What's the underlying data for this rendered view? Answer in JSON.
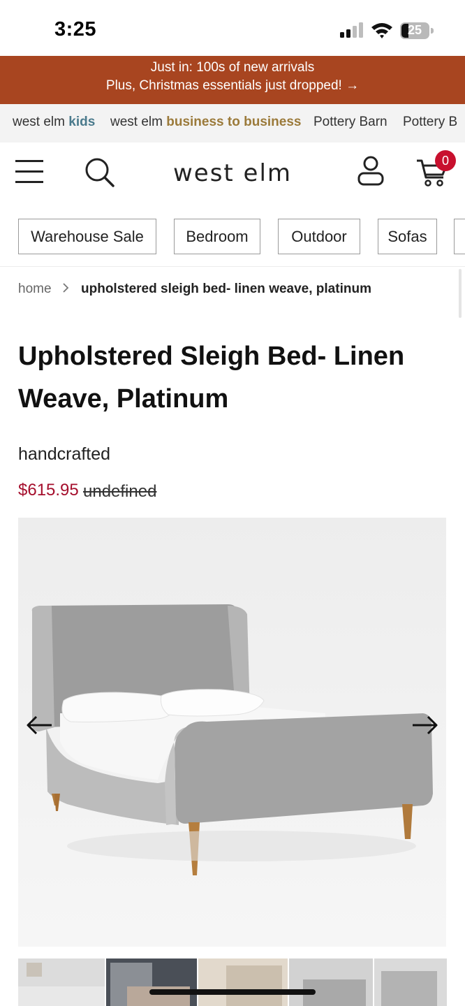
{
  "status_bar": {
    "time": "3:25",
    "battery": "25",
    "signal_icon": "cellular-signal-icon",
    "wifi_icon": "wifi-icon",
    "battery_icon": "battery-icon"
  },
  "promo": {
    "line1": "Just in: 100s of new arrivals",
    "line2": "Plus, Christmas essentials just dropped! →",
    "background": "#a84520"
  },
  "brand_strip": {
    "items": [
      {
        "prefix": "west elm ",
        "suffix": "kids"
      },
      {
        "prefix": "west elm ",
        "suffix": "business to business"
      },
      {
        "label": "Pottery Barn"
      },
      {
        "label": "Pottery B"
      }
    ]
  },
  "header": {
    "logo": "west elm",
    "cart_count": "0",
    "menu_icon": "hamburger-menu-icon",
    "search_icon": "search-icon",
    "account_icon": "account-icon",
    "cart_icon": "cart-icon"
  },
  "categories": [
    "Warehouse Sale",
    "Bedroom",
    "Outdoor",
    "Sofas"
  ],
  "breadcrumb": {
    "home": "home",
    "current": "upholstered sleigh bed- linen weave, platinum"
  },
  "product": {
    "title_line1": "Upholstered Sleigh Bed- Linen",
    "title_line2": "Weave, Platinum",
    "subtitle": "handcrafted",
    "price": "$615.95",
    "old_price": "undefined",
    "price_color": "#a50f2d"
  },
  "gallery": {
    "prev_icon": "arrow-left-icon",
    "next_icon": "arrow-right-icon"
  }
}
